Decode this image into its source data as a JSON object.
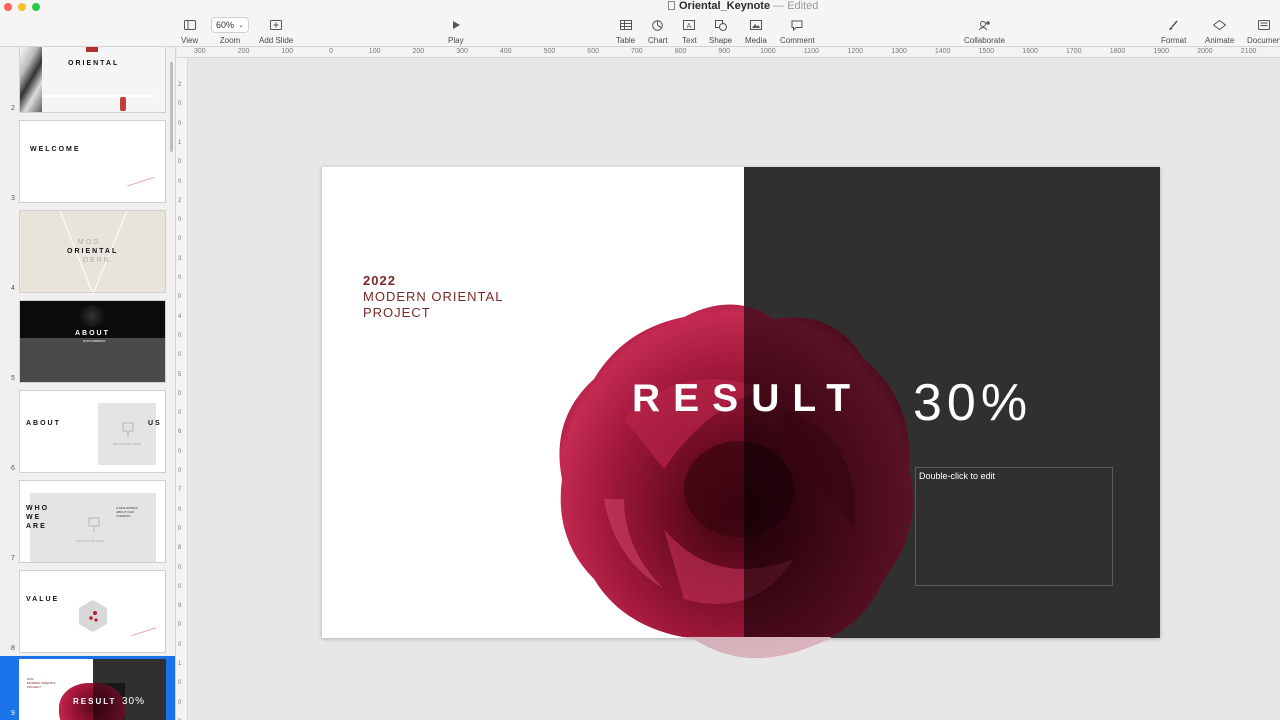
{
  "window": {
    "doc_name": "Oriental_Keynote",
    "separator": "—",
    "status": "Edited"
  },
  "toolbar": {
    "view": "View",
    "zoom_value": "60%",
    "zoom": "Zoom",
    "add_slide": "Add Slide",
    "play": "Play",
    "table": "Table",
    "chart": "Chart",
    "text": "Text",
    "shape": "Shape",
    "media": "Media",
    "comment": "Comment",
    "collaborate": "Collaborate",
    "format": "Format",
    "animate": "Animate",
    "document": "Documen"
  },
  "ruler": {
    "horizontal": [
      "300",
      "200",
      "100",
      "0",
      "100",
      "200",
      "300",
      "400",
      "500",
      "600",
      "700",
      "800",
      "900",
      "1000",
      "1100",
      "1200",
      "1300",
      "1400",
      "1500",
      "1600",
      "1700",
      "1800",
      "1900",
      "2000",
      "2100"
    ],
    "vertical": [
      "2",
      "0",
      "0",
      "1",
      "0",
      "0",
      "2",
      "0",
      "0",
      "3",
      "0",
      "0",
      "4",
      "0",
      "0",
      "5",
      "0",
      "0",
      "6",
      "0",
      "0",
      "7",
      "0",
      "0",
      "8",
      "0",
      "0",
      "9",
      "0",
      "0",
      "1",
      "0",
      "0",
      "0"
    ]
  },
  "navigator": {
    "slides": [
      {
        "number": "2",
        "title": "ORIENTAL"
      },
      {
        "number": "3",
        "title": "WELCOME"
      },
      {
        "number": "4",
        "title": "ORIENTAL",
        "pre": "MOD",
        "post": "DERN"
      },
      {
        "number": "5",
        "title": "ABOUT",
        "sub": "OUR COMPANY"
      },
      {
        "number": "6",
        "title": "ABOUT",
        "title2": "US",
        "ph_caption": "DROP IMAGE HERE"
      },
      {
        "number": "7",
        "title": "WHO WE ARE",
        "line1": "WHO",
        "line2": "WE",
        "line3": "ARE",
        "ph_caption": "DROP IMAGE HERE",
        "side_text": "A FEW WORDS ABOUT OUR COMPANY"
      },
      {
        "number": "8",
        "title": "VALUE"
      },
      {
        "number": "9",
        "year": "2022",
        "subtitle": "MODERN ORIENTAL PROJECT",
        "result": "RESULT",
        "percent": "30%"
      }
    ]
  },
  "slide": {
    "year": "2022",
    "subtitle": "MODERN ORIENTAL PROJECT",
    "result": "RESULT",
    "percent": "30%",
    "textbox_placeholder": "Double-click to edit"
  },
  "colors": {
    "accent": "#7b2828",
    "dark_panel": "#303030",
    "selection": "#1a73e8",
    "rose": "#a0183a"
  }
}
